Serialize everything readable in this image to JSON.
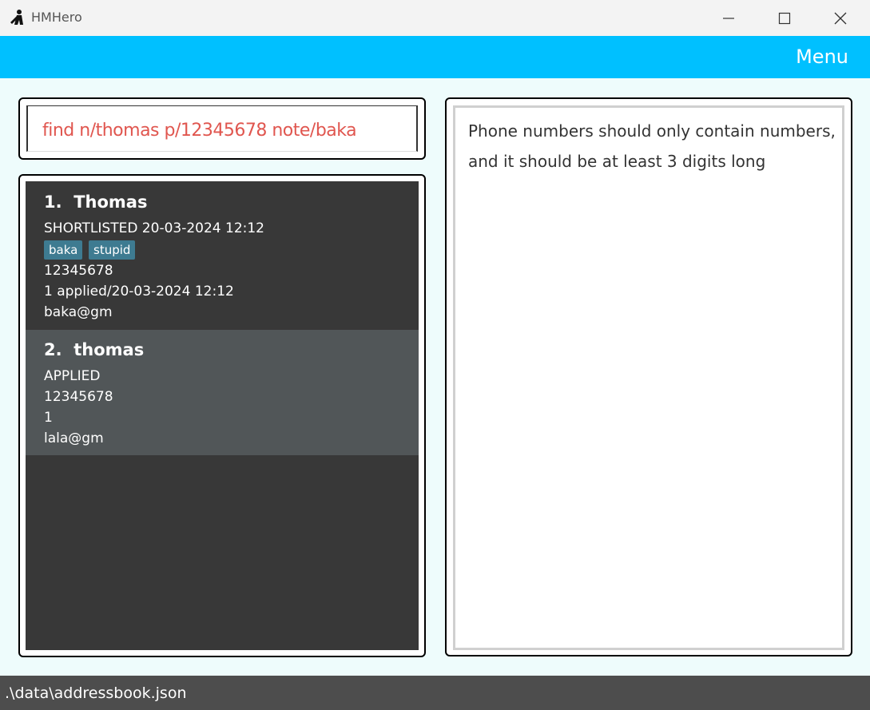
{
  "window": {
    "title": "HMHero",
    "controls": [
      "minimize-icon",
      "maximize-icon",
      "close-icon"
    ]
  },
  "menubar": {
    "menu_label": "Menu"
  },
  "command": {
    "value": "find n/thomas p/12345678 note/baka"
  },
  "result": {
    "message": "Phone numbers should only contain numbers, and it should be at least 3 digits long"
  },
  "persons": [
    {
      "index": "1.",
      "name": "Thomas",
      "status": "SHORTLISTED 20-03-2024 12:12",
      "tags": [
        "baka",
        "stupid"
      ],
      "phone": "12345678",
      "applied": "1 applied/20-03-2024 12:12",
      "email": "baka@gm"
    },
    {
      "index": "2.",
      "name": "thomas",
      "status": "APPLIED",
      "tags": [],
      "phone": "12345678",
      "applied": "1",
      "email": "lala@gm"
    }
  ],
  "statusbar": {
    "path": ".\\data\\addressbook.json"
  },
  "colors": {
    "menubar": "#00c0ff",
    "command_text": "#e0564f",
    "list_bg": "#383838",
    "selected_card": "#515658",
    "tag_bg": "#3e7b91",
    "statusbar": "#4d4d4d",
    "background": "#eefcfc"
  }
}
